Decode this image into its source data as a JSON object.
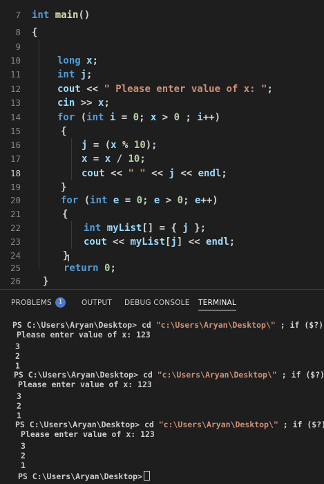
{
  "editor": {
    "line_numbers": [
      "7",
      "8",
      "9",
      "10",
      "11",
      "12",
      "13",
      "14",
      "15",
      "16",
      "17",
      "18",
      "19",
      "20",
      "21",
      "22",
      "23",
      "24",
      "25",
      "26"
    ],
    "active_line": "18",
    "lines": {
      "l7": [
        "int",
        " ",
        "main",
        "()"
      ],
      "l8": [
        "{"
      ],
      "l10": [
        "long",
        " ",
        "x",
        ";"
      ],
      "l11": [
        "int",
        " ",
        "j",
        ";"
      ],
      "l12": [
        "cout",
        " << ",
        "\" Please enter value of x: \"",
        ";"
      ],
      "l13": [
        "cin",
        " >> ",
        "x",
        ";"
      ],
      "l14": [
        "for",
        " (",
        "int",
        " ",
        "i",
        " = ",
        "0",
        "; ",
        "x",
        " > ",
        "0",
        " ; ",
        "i",
        "++)"
      ],
      "l15": [
        "{"
      ],
      "l16": [
        "j",
        " = (",
        "x",
        " % ",
        "10",
        ");"
      ],
      "l17": [
        "x",
        " = ",
        "x",
        " / ",
        "10",
        ";"
      ],
      "l18": [
        "cout",
        " << ",
        "\" \"",
        " << ",
        "j",
        " << ",
        "endl",
        ";"
      ],
      "l19": [
        "}"
      ],
      "l20": [
        "for",
        " (",
        "int",
        " ",
        "e",
        " = ",
        "0",
        "; ",
        "e",
        " > ",
        "0",
        "; ",
        "e",
        "++)"
      ],
      "l21": [
        "{"
      ],
      "l22": [
        "int",
        " ",
        "myList",
        "[] = { ",
        "j",
        " };"
      ],
      "l23": [
        "cout",
        " << ",
        "myList",
        "[",
        "j",
        "] << ",
        "endl",
        ";"
      ],
      "l24": [
        "}"
      ],
      "l25": [
        "return",
        " ",
        "0",
        ";"
      ],
      "l26": [
        "}"
      ]
    }
  },
  "panel": {
    "tabs": {
      "problems": "PROBLEMS",
      "problems_count": "1",
      "output": "OUTPUT",
      "debug_console": "DEBUG CONSOLE",
      "terminal": "TERMINAL"
    },
    "terminal": {
      "prompt": "PS C:\\Users\\Aryan\\Desktop>",
      "cmd_cd": " cd ",
      "cmd_path": "\"c:\\Users\\Aryan\\Desktop\\\"",
      "cmd_tail": " ; if ($?)",
      "enter_prompt": "Please enter value of x: 123",
      "out_3": "3",
      "out_2": "2",
      "out_1": "1"
    }
  },
  "colors": {
    "background": "#1e1e1e",
    "keyword": "#569cd6",
    "identifier": "#9cdcfe",
    "function": "#dcdcaa",
    "string": "#ce9178",
    "number": "#b5cea8",
    "badge": "#4d78cc"
  }
}
